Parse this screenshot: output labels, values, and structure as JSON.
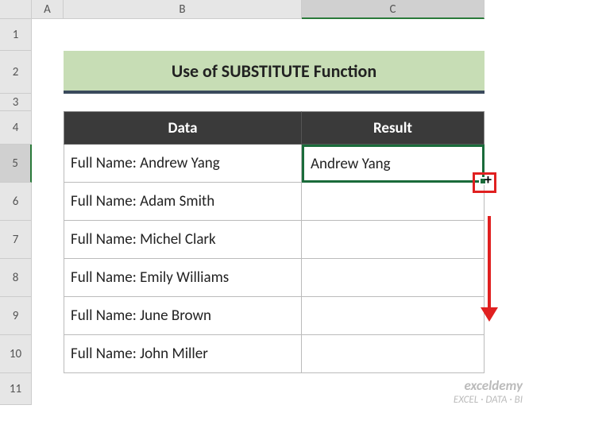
{
  "columns": {
    "a": "A",
    "b": "B",
    "c": "C"
  },
  "rows": [
    "1",
    "2",
    "3",
    "4",
    "5",
    "6",
    "7",
    "8",
    "9",
    "10",
    "11"
  ],
  "title": "Use of SUBSTITUTE Function",
  "headers": {
    "data": "Data",
    "result": "Result"
  },
  "data": [
    "Full Name: Andrew Yang",
    "Full Name: Adam Smith",
    "Full Name: Michel Clark",
    "Full Name: Emily Williams",
    "Full Name: June Brown",
    "Full Name: John Miller"
  ],
  "results": [
    "Andrew Yang",
    "",
    "",
    "",
    "",
    ""
  ],
  "watermark": {
    "brand": "exceldemy",
    "tag": "EXCEL · DATA · BI"
  },
  "fill_cursor": "+"
}
